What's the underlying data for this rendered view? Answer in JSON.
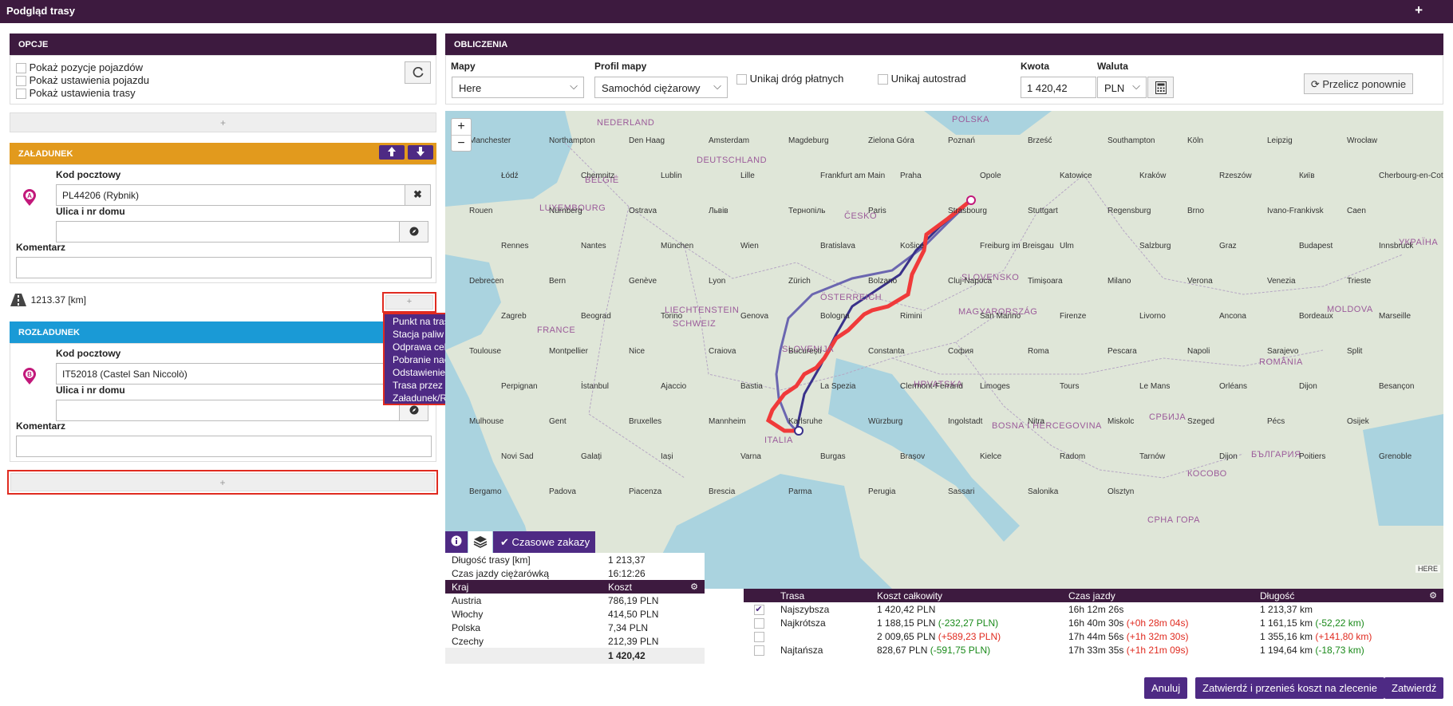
{
  "header": {
    "title": "Podgląd trasy",
    "plus": "+"
  },
  "options": {
    "title": "OPCJE",
    "items": [
      "Pokaż pozycje pojazdów",
      "Pokaż ustawienia pojazdu",
      "Pokaż ustawienia trasy"
    ],
    "refresh_icon": "refresh-icon",
    "add_label": "+"
  },
  "loading": {
    "title": "ZAŁADUNEK",
    "postal_label": "Kod pocztowy",
    "postal_value": "PL44206 (Rybnik)",
    "street_label": "Ulica i nr domu",
    "street_value": "",
    "comment_label": "Komentarz",
    "comment_value": "",
    "marker": "A",
    "accent": "#e29a1d"
  },
  "distance": {
    "value": "1213.37 [km]",
    "add_label": "+"
  },
  "dropdown": {
    "items": [
      "Punkt na trasie",
      "Stacja paliw",
      "Odprawa celna",
      "Pobranie naczepy",
      "Odstawienie naczepy",
      "Trasa przez",
      "Załadunek/Rozładunek"
    ]
  },
  "unloading": {
    "title": "ROZŁADUNEK",
    "postal_label": "Kod pocztowy",
    "postal_value": "IT52018 (Castel San Niccolò)",
    "street_label": "Ulica i nr domu",
    "street_value": "",
    "comment_label": "Komentarz",
    "comment_value": "",
    "marker": "B",
    "accent": "#1a9ad6"
  },
  "bottom_add": "+",
  "calc": {
    "title": "OBLICZENIA",
    "maps_label": "Mapy",
    "maps_value": "Here",
    "profile_label": "Profil mapy",
    "profile_value": "Samochód ciężarowy",
    "avoid_tolls": "Unikaj dróg płatnych",
    "avoid_highways": "Unikaj autostrad",
    "amount_label": "Kwota",
    "amount_value": "1 420,42",
    "currency_label": "Waluta",
    "currency_value": "PLN",
    "recalc": "Przelicz ponownie"
  },
  "map": {
    "zoom_in": "+",
    "zoom_out": "−",
    "labels": {
      "countries": [
        "NEDERLAND",
        "DEUTSCHLAND",
        "POLSKA",
        "BELGIË",
        "LUXEMBOURG",
        "ČESKO",
        "SLOVENSKO",
        "ÖSTERREICH",
        "SCHWEIZ",
        "LIECHTENSTEIN",
        "FRANCE",
        "MAGYARORSZÁG",
        "SLOVENIJA",
        "HRVATSKA",
        "ROMÂNIA",
        "MOLDOVA",
        "УКРАЇНА",
        "СРБИЈА",
        "BOSNA I HERCEGOVINA",
        "ITALIA",
        "БЪЛГАРИЯ",
        "КОСОВО",
        "CРНА ГОРА"
      ],
      "cities": [
        "Manchester",
        "Northampton",
        "Den Haag",
        "Amsterdam",
        "Magdeburg",
        "Zielona Góra",
        "Poznań",
        "Brześć",
        "Southampton",
        "Köln",
        "Leipzig",
        "Wrocław",
        "Łódź",
        "Chemnitz",
        "Lublin",
        "Lille",
        "Frankfurt am Main",
        "Praha",
        "Opole",
        "Katowice",
        "Kraków",
        "Rzeszów",
        "Київ",
        "Cherbourg-en-Cotentin",
        "Rouen",
        "Nürnberg",
        "Ostrava",
        "Львів",
        "Тернопіль",
        "Paris",
        "Strasbourg",
        "Stuttgart",
        "Regensburg",
        "Brno",
        "Ivano-Frankivsk",
        "Caen",
        "Rennes",
        "Nantes",
        "München",
        "Wien",
        "Bratislava",
        "Košice",
        "Freiburg im Breisgau",
        "Ulm",
        "Salzburg",
        "Graz",
        "Budapest",
        "Innsbruck",
        "Debrecen",
        "Bern",
        "Genève",
        "Lyon",
        "Zürich",
        "Bolzano",
        "Cluj-Napoca",
        "Timișoara",
        "Milano",
        "Verona",
        "Venezia",
        "Trieste",
        "Zagreb",
        "Beograd",
        "Torino",
        "Genova",
        "Bologna",
        "Rimini",
        "San Marino",
        "Firenze",
        "Livorno",
        "Ancona",
        "Bordeaux",
        "Marseille",
        "Toulouse",
        "Montpellier",
        "Nice",
        "Craiova",
        "București",
        "Constanta",
        "София",
        "Roma",
        "Pescara",
        "Napoli",
        "Sarajevo",
        "Split",
        "Perpignan",
        "İstanbul",
        "Ajaccio",
        "Bastia",
        "La Spezia",
        "Clermont-Ferrand",
        "Limoges",
        "Tours",
        "Le Mans",
        "Orléans",
        "Dijon",
        "Besançon",
        "Mulhouse",
        "Gent",
        "Bruxelles",
        "Mannheim",
        "Karlsruhe",
        "Würzburg",
        "Ingolstadt",
        "Nitra",
        "Miskolc",
        "Szeged",
        "Pécs",
        "Osijek",
        "Novi Sad",
        "Galați",
        "Iași",
        "Varna",
        "Burgas",
        "Brașov",
        "Kielce",
        "Radom",
        "Tarnów",
        "Dijon",
        "Poitiers",
        "Grenoble",
        "Bergamo",
        "Padova",
        "Piacenza",
        "Brescia",
        "Parma",
        "Perugia",
        "Sassari",
        "Salonika",
        "Olsztyn"
      ],
      "attribution": "HERE"
    }
  },
  "route_info": {
    "tab_time": "Czasowe zakazy",
    "info_icon": "info-icon",
    "layers_icon": "layers-icon",
    "length_label": "Długość trasy [km]",
    "length_value": "1 213,37",
    "time_label": "Czas jazdy ciężarówką",
    "time_value": "16:12:26",
    "col_country": "Kraj",
    "col_cost": "Koszt",
    "rows": [
      {
        "country": "Austria",
        "cost": "786,19 PLN"
      },
      {
        "country": "Włochy",
        "cost": "414,50 PLN"
      },
      {
        "country": "Polska",
        "cost": "7,34 PLN"
      },
      {
        "country": "Czechy",
        "cost": "212,39 PLN"
      }
    ],
    "total": "1 420,42"
  },
  "routes": {
    "col_route": "Trasa",
    "col_cost": "Koszt całkowity",
    "col_time": "Czas jazdy",
    "col_length": "Długość",
    "rows": [
      {
        "checked": true,
        "name": "Najszybsza",
        "cost": "1 420,42 PLN",
        "cost_diff": "",
        "cost_color": "",
        "time": "16h 12m 26s",
        "time_diff": "",
        "length": "1 213,37 km",
        "length_diff": "",
        "len_color": ""
      },
      {
        "checked": false,
        "name": "Najkrótsza",
        "cost": "1 188,15 PLN",
        "cost_diff": "(-232,27 PLN)",
        "cost_color": "#1a8a1a",
        "time": "16h 40m 30s",
        "time_diff": "(+0h 28m 04s)",
        "length": "1 161,15 km",
        "length_diff": "(-52,22 km)",
        "len_color": "#1a8a1a"
      },
      {
        "checked": false,
        "name": "",
        "cost": "2 009,65 PLN",
        "cost_diff": "(+589,23 PLN)",
        "cost_color": "#e02b20",
        "time": "17h 44m 56s",
        "time_diff": "(+1h 32m 30s)",
        "length": "1 355,16 km",
        "length_diff": "(+141,80 km)",
        "len_color": "#e02b20"
      },
      {
        "checked": false,
        "name": "Najtańsza",
        "cost": "828,67 PLN",
        "cost_diff": "(-591,75 PLN)",
        "cost_color": "#1a8a1a",
        "time": "17h 33m 35s",
        "time_diff": "(+1h 21m 09s)",
        "length": "1 194,64 km",
        "length_diff": "(-18,73 km)",
        "len_color": "#1a8a1a"
      }
    ]
  },
  "footer": {
    "cancel": "Anuluj",
    "confirm_transfer": "Zatwierdź i przenieś koszt na zlecenie",
    "confirm": "Zatwierdź"
  },
  "colors": {
    "header": "#3d1a3f",
    "button": "#4e2a84",
    "route_red": "#f03a3a",
    "route_blue": "#39318a",
    "route_alt": "#6b66b0"
  }
}
